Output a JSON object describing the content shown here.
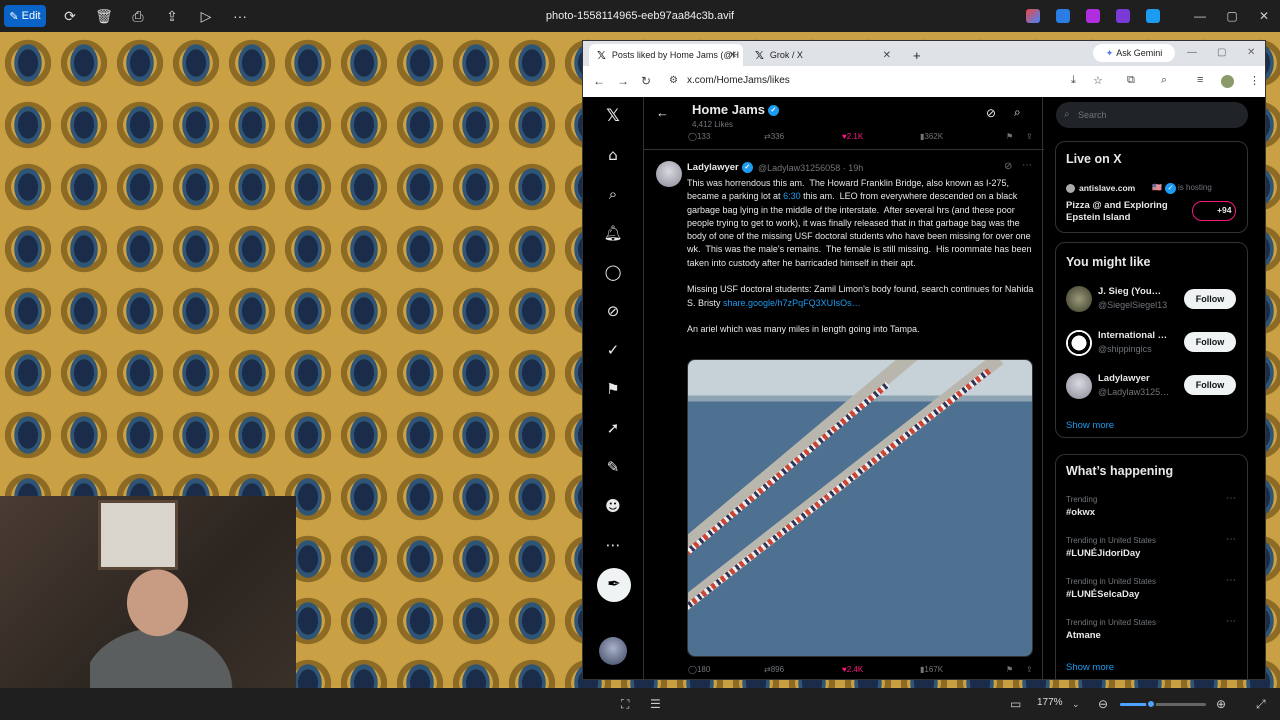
{
  "viewer": {
    "edit_label": "Edit",
    "file_title": "photo-1558114965-eeb97aa84c3b.avif",
    "zoom": "177%",
    "zoom_level": 0.36
  },
  "browser": {
    "tabs": [
      {
        "label": "Posts liked by Home Jams (@H"
      },
      {
        "label": "Grok / X"
      }
    ],
    "new_tab": "+",
    "gemini": "Ask Gemini",
    "url": "x.com/HomeJams/likes"
  },
  "x": {
    "profile_name": "Home Jams",
    "likes_count": "4,412 Likes",
    "top_actions": {
      "replies": "133",
      "reposts": "336",
      "likes": "2.1K",
      "views": "362K"
    },
    "post": {
      "author": "Ladylawyer",
      "handle": "@Ladylaw31256058 · 19h",
      "text_a": "This was horrendous this am.  The Howard Franklin Bridge, also known as I-275, became a parking lot at ",
      "time_link": "6:30",
      "text_b": " this am.  LEO from everywhere descended on a black garbage bag lying in the middle of the interstate.  After several hrs (and these poor people trying to get to work), it was finally released that in that garbage bag was the body of one of the missing USF doctoral students who have been missing for over one wk.  This was the male's remains.  The female is still missing.  His roommate has been taken into custody after he barricaded himself in their apt.\n\nMissing USF doctoral students: Zamil Limon's body found, search continues for Nahida S. Bristy ",
      "share_link": "share.google/h7zPqFQ3XUIsOs…",
      "text_c": "\n\nAn ariel which was many miles in length going into Tampa.",
      "actions": {
        "replies": "180",
        "reposts": "896",
        "likes": "2.4K",
        "views": "167K"
      }
    },
    "search_placeholder": "Search",
    "live": {
      "title": "Live on X",
      "host": "antislave.com",
      "hosting": "is hosting",
      "topic": "Pizza @ and Exploring Epstein Island",
      "listeners": "+94"
    },
    "you_might_like": {
      "title": "You might like",
      "users": [
        {
          "name": "J. Sieg (You…",
          "handle": "@SiegelSiegel13",
          "button": "Follow"
        },
        {
          "name": "International …",
          "handle": "@shippingics",
          "button": "Follow"
        },
        {
          "name": "Ladylawyer",
          "handle": "@Ladylaw3125…",
          "button": "Follow"
        }
      ],
      "show_more": "Show more"
    },
    "whats_happening": {
      "title": "What’s happening",
      "trends": [
        {
          "context": "Trending",
          "name": "#okwx"
        },
        {
          "context": "Trending in United States",
          "name": "#LUNÉJidoriDay"
        },
        {
          "context": "Trending in United States",
          "name": "#LUNÉSelcaDay"
        },
        {
          "context": "Trending in United States",
          "name": "Atmane"
        }
      ],
      "show_more": "Show more"
    }
  }
}
